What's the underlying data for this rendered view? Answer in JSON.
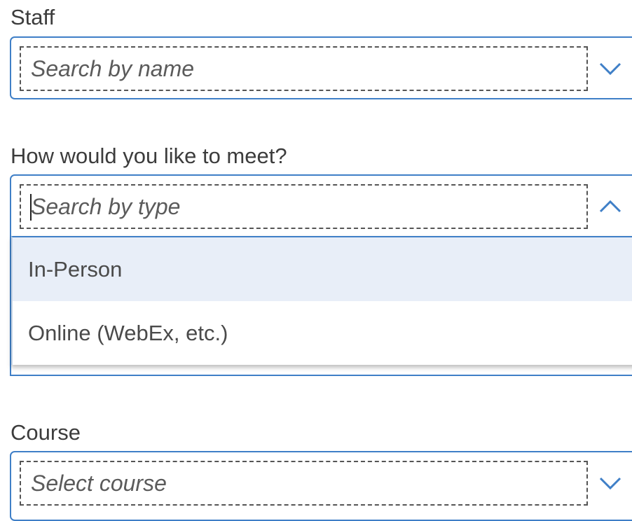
{
  "staff": {
    "label": "Staff",
    "placeholder": "Search by name",
    "chevron": "chevron-down-icon"
  },
  "meeting": {
    "label": "How would you like to meet?",
    "placeholder": "Search by type",
    "chevron": "chevron-up-icon",
    "expanded": true,
    "options": [
      {
        "label": "In-Person",
        "highlighted": true
      },
      {
        "label": "Online (WebEx, etc.)",
        "highlighted": false
      }
    ]
  },
  "course": {
    "label": "Course",
    "placeholder": "Select course",
    "chevron": "chevron-down-icon"
  },
  "colors": {
    "accent": "#3f7fc7",
    "highlight": "#e8eef8",
    "text": "#3c3c3c"
  }
}
